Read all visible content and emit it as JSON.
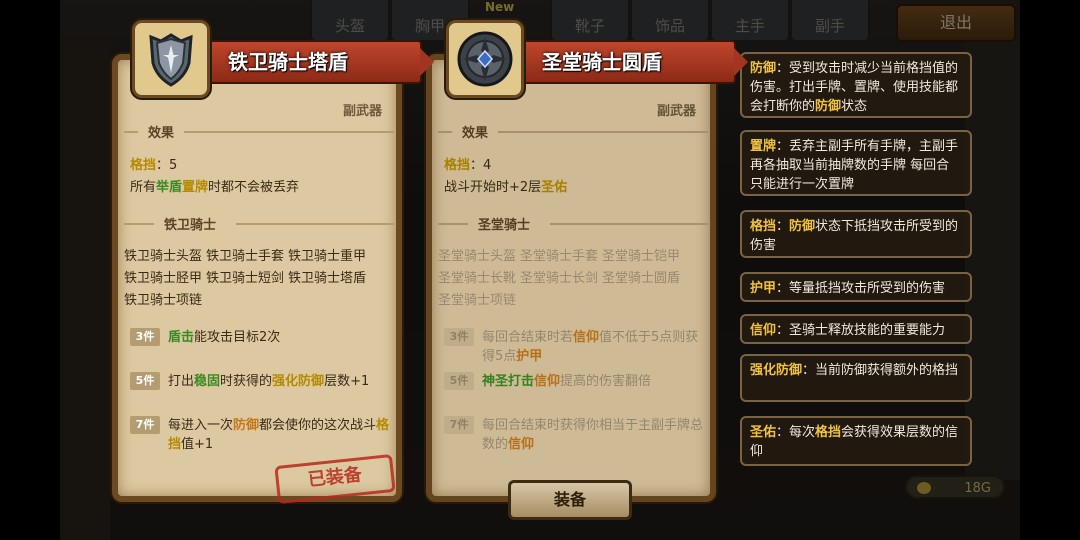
{
  "tabs": [
    "头盔",
    "胸甲",
    "靴子",
    "饰品",
    "主手",
    "副手"
  ],
  "new_tag": "New",
  "exit_label": "退出",
  "gold_amount": "18G",
  "equip_button": "装备",
  "equipped_stamp": "已装备",
  "colors": {
    "highlight_yellow": "#b58a00",
    "highlight_green": "#3a8a21",
    "banner_red": "#a33520"
  },
  "card_left": {
    "name": "铁卫骑士塔盾",
    "type": "副武器",
    "icon": "iron-tower-shield-icon",
    "effect_title": "效果",
    "block_label": "格挡",
    "block_value": "：5",
    "effect_line2_a": "所有",
    "effect_line2_hl1": "举盾",
    "effect_line2_hl2": "置牌",
    "effect_line2_b": "时都不会被丢弃",
    "set_title": "铁卫骑士",
    "set_items": [
      "铁卫骑士头盔",
      "铁卫骑士手套",
      "铁卫骑士重甲",
      "铁卫骑士胫甲",
      "铁卫骑士短剑",
      "铁卫骑士塔盾",
      "铁卫骑士项链"
    ],
    "bonuses": [
      {
        "count": "3件",
        "hl": "盾击",
        "text": "能攻击目标2次"
      },
      {
        "count": "5件",
        "pre": "打出",
        "hl": "稳固",
        "mid": "时获得的",
        "hl2": "强化防御",
        "post": "层数+1"
      },
      {
        "count": "7件",
        "pre": "每进入一次",
        "hl": "防御",
        "mid": "都会使你的这次战斗",
        "hl2": "格挡",
        "post": "值+1"
      }
    ]
  },
  "card_right": {
    "name": "圣堂骑士圆盾",
    "type": "副武器",
    "icon": "templar-round-shield-icon",
    "effect_title": "效果",
    "block_label": "格挡",
    "block_value": "：4",
    "effect_line2_a": "战斗开始时+2层",
    "effect_line2_hl": "圣佑",
    "set_title": "圣堂骑士",
    "set_items": [
      "圣堂骑士头盔",
      "圣堂骑士手套",
      "圣堂骑士铠甲",
      "圣堂骑士长靴",
      "圣堂骑士长剑",
      "圣堂骑士圆盾",
      "圣堂骑士项链"
    ],
    "bonuses": [
      {
        "count": "3件",
        "pre": "每回合结束时若",
        "hl": "信仰",
        "mid": "值不低于5点则获得5点",
        "hl2": "护甲"
      },
      {
        "count": "5件",
        "hl": "神圣打击",
        "hl2": "信仰",
        "post": "提高的伤害翻倍"
      },
      {
        "count": "7件",
        "pre": "每回合结束时获得你相当于主副手牌总数的",
        "hl": "信仰"
      }
    ]
  },
  "tooltips": [
    {
      "key": "防御",
      "pre": "：受到攻击时减少当前格挡值的伤害。打出手牌、置牌、使用技能都会打断你的",
      "hl": "防御",
      "post": "状态"
    },
    {
      "key": "置牌",
      "pre": "：丢弃主副手所有手牌，主副手再各抽取当前抽牌数的手牌 每回合只能进行一次置牌"
    },
    {
      "key": "格挡",
      "pre": "：",
      "hl": "防御",
      "post": "状态下抵挡攻击所受到的伤害"
    },
    {
      "key": "护甲",
      "pre": "：等量抵挡攻击所受到的伤害"
    },
    {
      "key": "信仰",
      "pre": "：圣骑士释放技能的重要能力"
    },
    {
      "key": "强化防御",
      "pre": "：当前防御获得额外的格挡"
    },
    {
      "key": "圣佑",
      "pre": "：每次",
      "hl": "格挡",
      "post": "会获得效果层数的信仰"
    }
  ]
}
